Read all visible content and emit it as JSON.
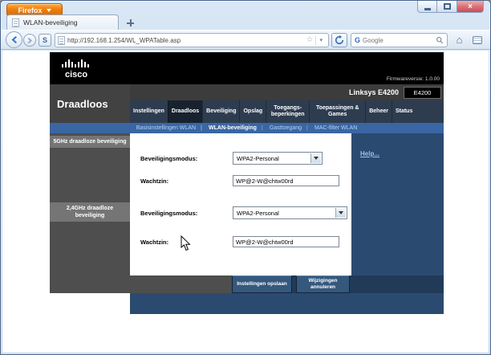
{
  "browser": {
    "firefox_button": "Firefox",
    "tab_title": "WLAN-beveiliging",
    "url": "http://192.168.1.254/WL_WPATable.asp",
    "search_text": "Google"
  },
  "icons": {
    "extension": "S",
    "google": "G",
    "star": "☆",
    "caret": "▾",
    "home": "⌂",
    "close": "×"
  },
  "router": {
    "brand": "cisco",
    "firmware": "Firmwareversie: 1.0.00",
    "model_name": "Linksys E4200",
    "model_badge": "E4200",
    "page_title": "Draadloos",
    "menu": [
      {
        "label": "Instellingen"
      },
      {
        "label": "Draadloos"
      },
      {
        "label": "Beveiliging"
      },
      {
        "label": "Opslag"
      },
      {
        "label": "Toegangs-beperkingen"
      },
      {
        "label": "Toepassingen & Games"
      },
      {
        "label": "Beheer"
      },
      {
        "label": "Status"
      }
    ],
    "submenu": [
      {
        "label": "Basisinstellingen WLAN"
      },
      {
        "label": "WLAN-beveiliging"
      },
      {
        "label": "Gasttoegang"
      },
      {
        "label": "MAC-filter WLAN"
      }
    ],
    "sections": [
      {
        "sidebar_title": "5GHz draadloze beveiliging",
        "mode_label": "Beveiligingsmodus:",
        "mode_value": "WPA2-Personal",
        "pass_label": "Wachtzin:",
        "pass_value": "WP@2-W@chtw00rd"
      },
      {
        "sidebar_title": "2,4GHz draadloze beveiliging",
        "mode_label": "Beveiligingsmodus:",
        "mode_value": "WPA2-Personal",
        "pass_label": "Wachtzin:",
        "pass_value": "WP@2-W@chtw00rd"
      }
    ],
    "help_link": "Help...",
    "save_button": "Instellingen opslaan",
    "cancel_button": "Wijzigingen annuleren"
  },
  "colors": {
    "navy": "#2b4a70",
    "menu_bar": "#2e3c50",
    "submenu_bar": "#3a66a4",
    "sidebar_gray": "#4e4e4e",
    "label_gray": "#757575",
    "firefox_orange": "#f07d05"
  }
}
